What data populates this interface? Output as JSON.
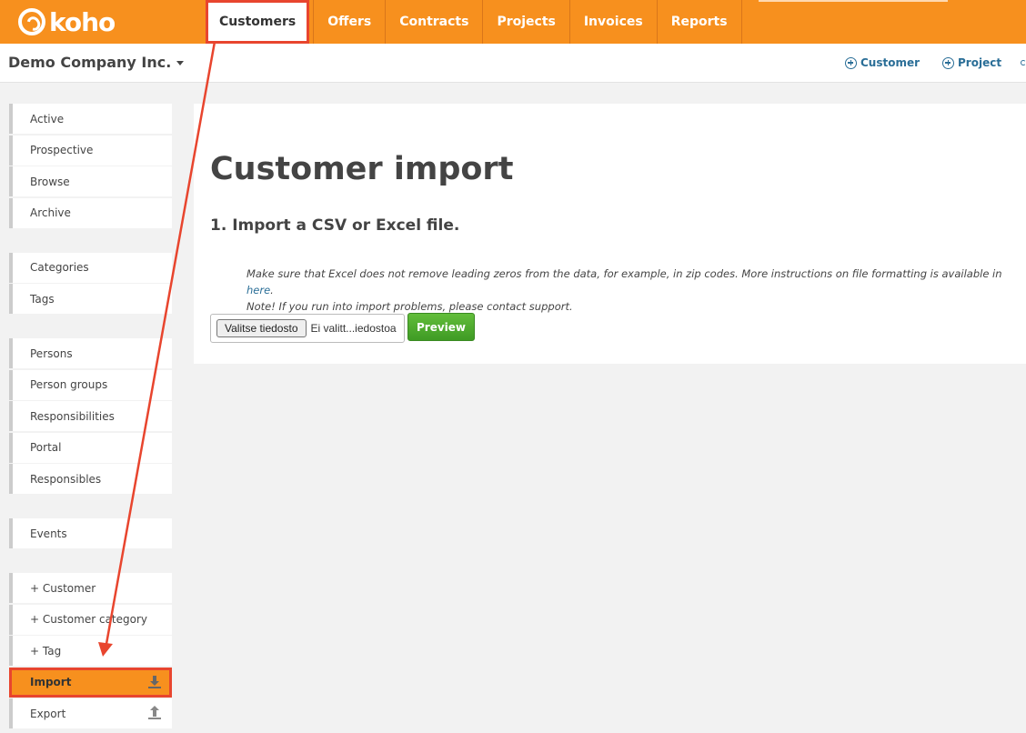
{
  "brand": {
    "name": "koho"
  },
  "nav": {
    "tabs": [
      {
        "label": "Customers",
        "active": true
      },
      {
        "label": "Offers"
      },
      {
        "label": "Contracts"
      },
      {
        "label": "Projects"
      },
      {
        "label": "Invoices"
      },
      {
        "label": "Reports"
      }
    ]
  },
  "header": {
    "company": "Demo Company Inc.",
    "quick_actions": [
      {
        "label": "Customer",
        "icon": "plus-circle-icon"
      },
      {
        "label": "Project",
        "icon": "plus-circle-icon"
      }
    ]
  },
  "sidebar": {
    "groups": [
      [
        {
          "label": "Active"
        },
        {
          "label": "Prospective"
        },
        {
          "label": "Browse"
        },
        {
          "label": "Archive"
        }
      ],
      [
        {
          "label": "Categories"
        },
        {
          "label": "Tags"
        }
      ],
      [
        {
          "label": "Persons"
        },
        {
          "label": "Person groups"
        },
        {
          "label": "Responsibilities"
        },
        {
          "label": "Portal"
        },
        {
          "label": "Responsibles"
        }
      ],
      [
        {
          "label": "Events"
        }
      ],
      [
        {
          "label": "+ Customer"
        },
        {
          "label": "+ Customer category"
        },
        {
          "label": "+ Tag"
        },
        {
          "label": "Import",
          "active": true,
          "icon": "download-icon"
        },
        {
          "label": "Export",
          "icon": "upload-icon"
        }
      ]
    ]
  },
  "main": {
    "title": "Customer import",
    "step": "1. Import a CSV or Excel file.",
    "instructions_line1": "Make sure that Excel does not remove leading zeros from the data, for example, in zip codes. More instructions on file formatting is available in",
    "instructions_link": "here",
    "instructions_line1_end": ".",
    "instructions_line2": "Note! If you run into import problems, please contact support.",
    "file_button": "Valitse tiedosto",
    "file_status": "Ei valitt...iedostoa",
    "preview_button": "Preview"
  },
  "colors": {
    "brand_orange": "#f7901e",
    "link_blue": "#2a6e97",
    "preview_green": "#4caf2e",
    "annotation_red": "#e8452e"
  }
}
